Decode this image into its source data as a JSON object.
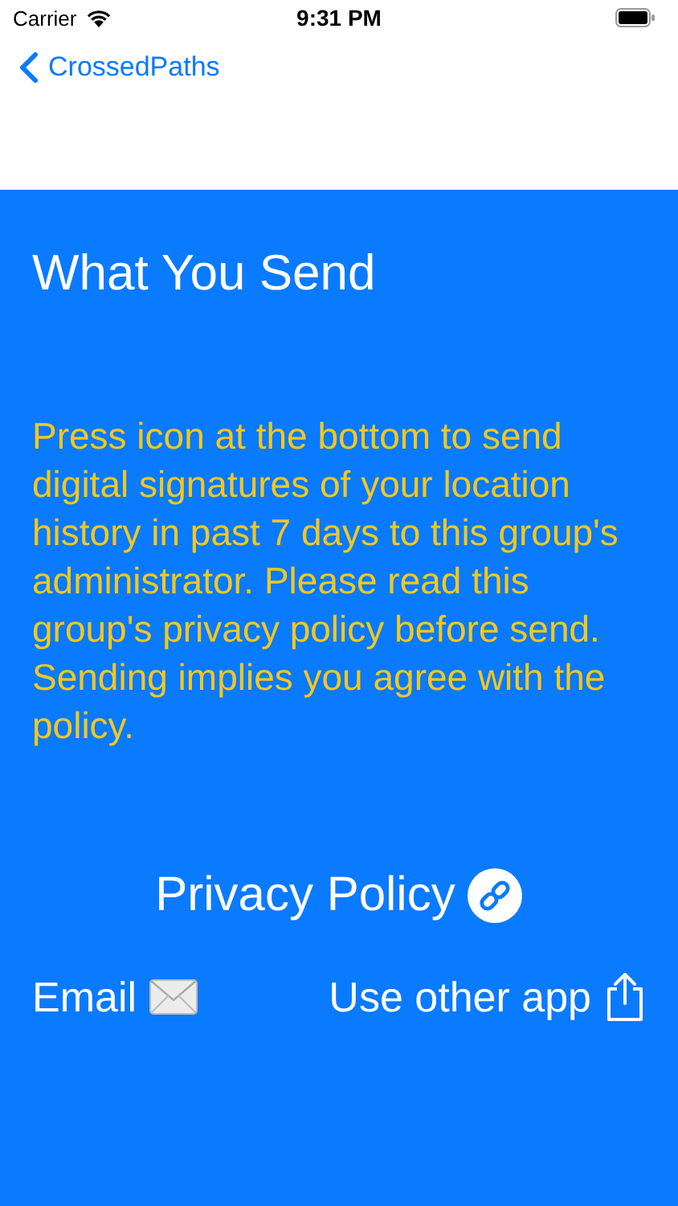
{
  "status_bar": {
    "carrier": "Carrier",
    "time": "9:31 PM"
  },
  "nav": {
    "back_label": "CrossedPaths"
  },
  "title": "What You Send",
  "description": "Press icon at the bottom to send digital signatures of your location history in past 7 days to this group's administrator. Please read this group's privacy policy before send. Sending implies you agree with the policy.",
  "privacy_link": "Privacy Policy",
  "actions": [
    {
      "kind": "email",
      "label": "Email"
    },
    {
      "kind": "share",
      "label": "Use other app"
    }
  ]
}
